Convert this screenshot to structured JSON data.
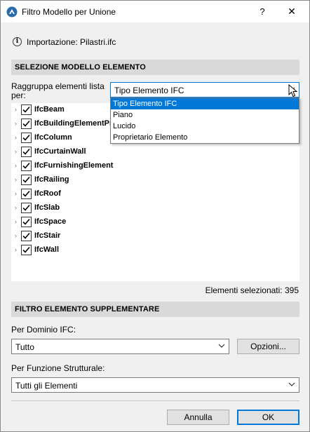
{
  "window": {
    "title": "Filtro Modello per Unione",
    "help_label": "?",
    "close_label": "✕"
  },
  "info": {
    "text": "Importazione: Pilastri.ifc"
  },
  "section_selection": {
    "header": "SELEZIONE MODELLO ELEMENTO",
    "group_label": "Raggruppa elementi lista per:",
    "group_combo_value": "Tipo Elemento IFC",
    "dropdown_options": [
      "Tipo Elemento IFC",
      "Piano",
      "Lucido",
      "Proprietario Elemento"
    ],
    "tree_items": [
      {
        "label": "IfcBeam",
        "checked": true
      },
      {
        "label": "IfcBuildingElementPr",
        "checked": true
      },
      {
        "label": "IfcColumn",
        "checked": true
      },
      {
        "label": "IfcCurtainWall",
        "checked": true
      },
      {
        "label": "IfcFurnishingElement",
        "checked": true
      },
      {
        "label": "IfcRailing",
        "checked": true
      },
      {
        "label": "IfcRoof",
        "checked": true
      },
      {
        "label": "IfcSlab",
        "checked": true
      },
      {
        "label": "IfcSpace",
        "checked": true
      },
      {
        "label": "IfcStair",
        "checked": true
      },
      {
        "label": "IfcWall",
        "checked": true
      }
    ],
    "selected_count": "Elementi selezionati: 395"
  },
  "section_filter": {
    "header": "FILTRO ELEMENTO SUPPLEMENTARE",
    "domain_label": "Per Dominio IFC:",
    "domain_value": "Tutto",
    "options_button": "Opzioni...",
    "function_label": "Per Funzione Strutturale:",
    "function_value": "Tutti gli Elementi"
  },
  "footer": {
    "cancel_label": "Annulla",
    "ok_label": "OK"
  },
  "colors": {
    "accent": "#0078d7",
    "section_bg": "#d9d9d9",
    "window_bg": "#f0f0f0"
  }
}
